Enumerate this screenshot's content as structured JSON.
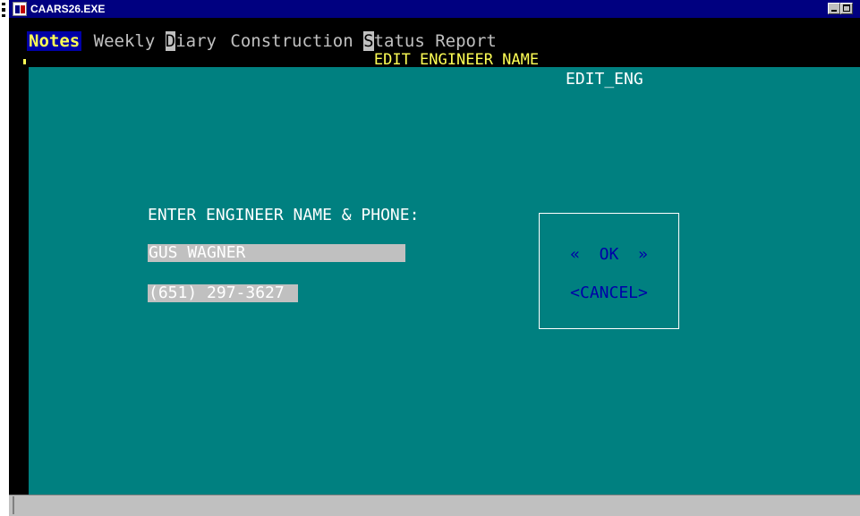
{
  "window": {
    "title": "CAARS26.EXE",
    "icon": "app-icon"
  },
  "menu": {
    "items": [
      {
        "label": "Notes",
        "active": true
      },
      {
        "label": "Weekly "
      },
      {
        "hotkey": "D",
        "label": "iary"
      },
      {
        "label": "Construction "
      },
      {
        "hotkey": "S",
        "label": "tatus Report"
      }
    ]
  },
  "screen": {
    "title": "EDIT ENGINEER NAME",
    "id": "EDIT_ENG"
  },
  "form": {
    "prompt": "ENTER ENGINEER NAME & PHONE:",
    "name_value": "GUS WAGNER",
    "phone_value": "(651) 297-3627"
  },
  "dialog": {
    "ok_label": "«  OK  »",
    "cancel_label": "<CANCEL>"
  },
  "colors": {
    "background": "#008080",
    "menu_active_bg": "#0000a8",
    "menu_active_fg": "#ffff55",
    "title": "#ffff55",
    "field_bg": "#c0c0c0",
    "button_text": "#0000a8",
    "titlebar": "#000080"
  }
}
